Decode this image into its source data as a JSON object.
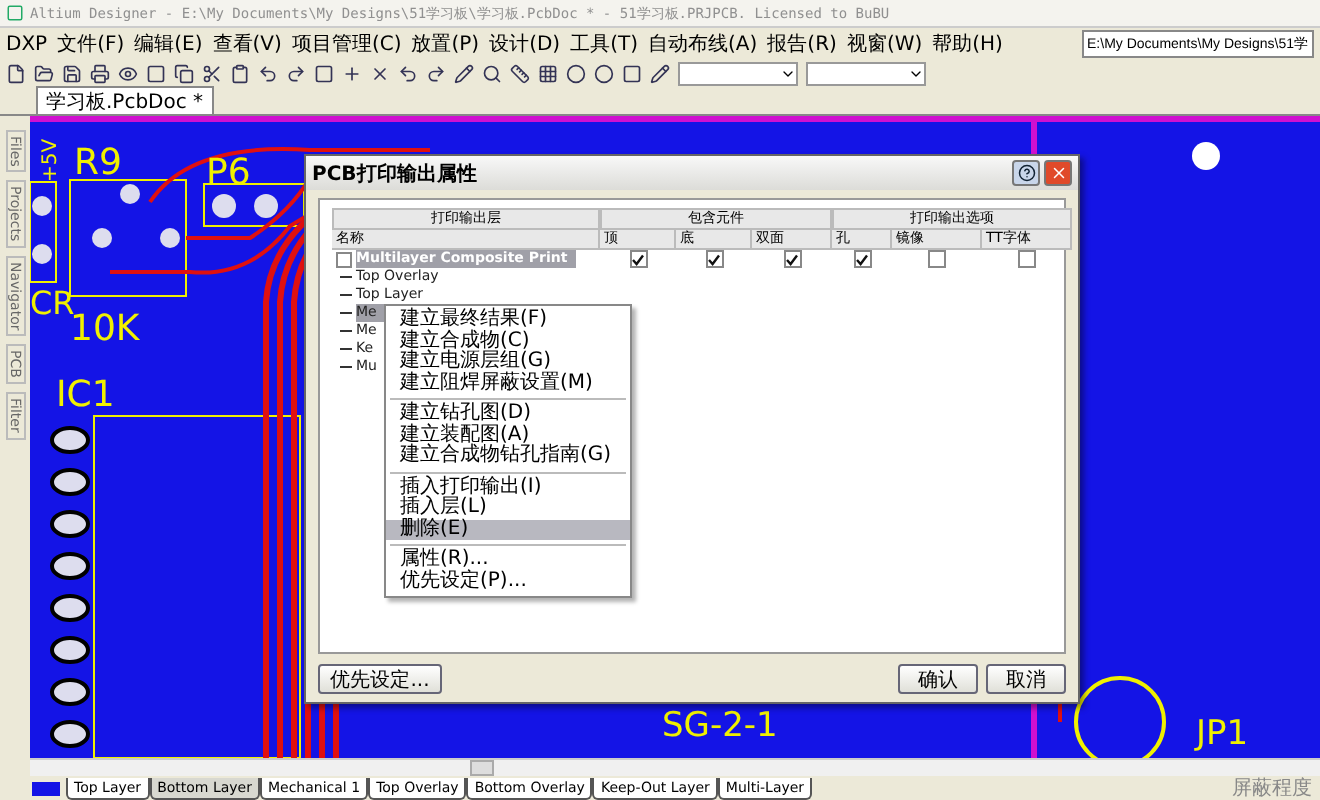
{
  "window": {
    "title": "Altium Designer - E:\\My Documents\\My Designs\\51学习板\\学习板.PcbDoc * - 51学习板.PRJPCB. Licensed to BuBU"
  },
  "menu": [
    "DXP",
    "文件(F)",
    "编辑(E)",
    "查看(V)",
    "项目管理(C)",
    "放置(P)",
    "设计(D)",
    "工具(T)",
    "自动布线(A)",
    "报告(R)",
    "视窗(W)",
    "帮助(H)"
  ],
  "path_box": {
    "value": "E:\\My Documents\\My Designs\\51学"
  },
  "document_tab": {
    "label": "学习板.PcbDoc *",
    "selected": true
  },
  "side_panels": [
    "Files",
    "Projects",
    "Navigator",
    "PCB",
    "Filter"
  ],
  "pcb_labels": [
    "+5V",
    "R9",
    "P6",
    "CR",
    "10K",
    "IC1",
    "SG-2-1",
    "JP1"
  ],
  "dialog": {
    "title": "PCB打印输出属性",
    "group_headers": [
      "打印输出层",
      "包含元件",
      "打印输出选项"
    ],
    "columns": [
      "名称",
      "顶",
      "底",
      "双面",
      "孔",
      "镜像",
      "TT字体"
    ],
    "rows": [
      {
        "name": "Multilayer Composite Print",
        "selected": true,
        "checks": [
          true,
          true,
          true,
          true,
          false,
          false
        ],
        "children": [
          {
            "name": "Top Overlay",
            "selected": false
          },
          {
            "name": "Top Layer",
            "selected": false
          },
          {
            "name": "Me",
            "selected": true
          },
          {
            "name": "Me",
            "selected": false
          },
          {
            "name": "Ke",
            "selected": false
          },
          {
            "name": "Mu",
            "selected": false
          }
        ]
      }
    ],
    "buttons": [
      "优先设定...",
      "确认",
      "取消"
    ]
  },
  "context_menu": [
    {
      "kind": "item",
      "label": "建立最终结果(F)",
      "selected": false
    },
    {
      "kind": "item",
      "label": "建立合成物(C)",
      "selected": false
    },
    {
      "kind": "item",
      "label": "建立电源层组(G)",
      "selected": false
    },
    {
      "kind": "item",
      "label": "建立阻焊屏蔽设置(M)",
      "selected": false
    },
    {
      "kind": "separator"
    },
    {
      "kind": "item",
      "label": "建立钻孔图(D)",
      "selected": false
    },
    {
      "kind": "item",
      "label": "建立装配图(A)",
      "selected": false
    },
    {
      "kind": "item",
      "label": "建立合成物钻孔指南(G)",
      "selected": false
    },
    {
      "kind": "separator"
    },
    {
      "kind": "item",
      "label": "插入打印输出(I)",
      "selected": false
    },
    {
      "kind": "item",
      "label": "插入层(L)",
      "selected": false
    },
    {
      "kind": "item",
      "label": "删除(E)",
      "selected": true
    },
    {
      "kind": "separator"
    },
    {
      "kind": "item",
      "label": "属性(R)...",
      "selected": false
    },
    {
      "kind": "item",
      "label": "优先设定(P)...",
      "selected": false
    }
  ],
  "layer_tabs": [
    {
      "label": "Top Layer",
      "selected": false
    },
    {
      "label": "Bottom Layer",
      "selected": true
    },
    {
      "label": "Mechanical 1",
      "selected": false
    },
    {
      "label": "Top Overlay",
      "selected": false
    },
    {
      "label": "Bottom Overlay",
      "selected": false
    },
    {
      "label": "Keep-Out Layer",
      "selected": false
    },
    {
      "label": "Multi-Layer",
      "selected": false
    }
  ],
  "status_right": "屏蔽程度"
}
